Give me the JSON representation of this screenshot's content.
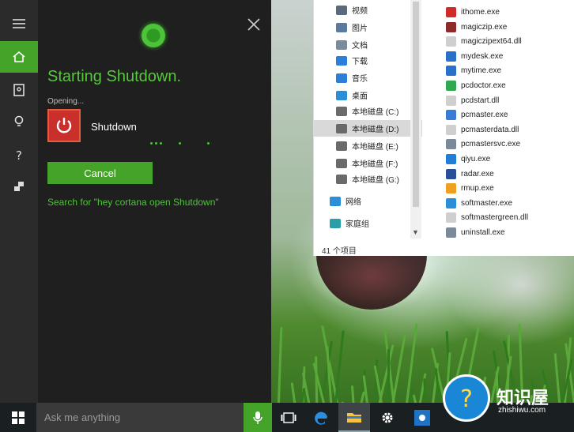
{
  "cortana": {
    "title": "Starting Shutdown.",
    "opening": "Opening...",
    "app_name": "Shutdown",
    "cancel_label": "Cancel",
    "search_link": "Search for \"hey cortana open Shutdown\"",
    "accent": "#45a32a"
  },
  "explorer": {
    "nav": [
      {
        "label": "视频",
        "icon": "video-icon"
      },
      {
        "label": "图片",
        "icon": "pictures-icon"
      },
      {
        "label": "文档",
        "icon": "documents-icon"
      },
      {
        "label": "下载",
        "icon": "downloads-icon"
      },
      {
        "label": "音乐",
        "icon": "music-icon"
      },
      {
        "label": "桌面",
        "icon": "desktop-icon"
      },
      {
        "label": "本地磁盘 (C:)",
        "icon": "drive-icon"
      },
      {
        "label": "本地磁盘 (D:)",
        "icon": "drive-icon",
        "selected": true
      },
      {
        "label": "本地磁盘 (E:)",
        "icon": "drive-icon"
      },
      {
        "label": "本地磁盘 (F:)",
        "icon": "drive-icon"
      },
      {
        "label": "本地磁盘 (G:)",
        "icon": "drive-icon"
      },
      {
        "label": "网络",
        "icon": "network-icon"
      },
      {
        "label": "家庭组",
        "icon": "homegroup-icon"
      }
    ],
    "files": [
      {
        "name": "ithome.exe",
        "color": "#d12a2a"
      },
      {
        "name": "magiczip.exe",
        "color": "#8b2b2b"
      },
      {
        "name": "magiczipext64.dll",
        "color": "#cfcfcf"
      },
      {
        "name": "mydesk.exe",
        "color": "#2a6fc9"
      },
      {
        "name": "mytime.exe",
        "color": "#2a6fc9"
      },
      {
        "name": "pcdoctor.exe",
        "color": "#2fa84f"
      },
      {
        "name": "pcdstart.dll",
        "color": "#cfcfcf"
      },
      {
        "name": "pcmaster.exe",
        "color": "#3a7bd5"
      },
      {
        "name": "pcmasterdata.dll",
        "color": "#cfcfcf"
      },
      {
        "name": "pcmastersvc.exe",
        "color": "#7a8a9a"
      },
      {
        "name": "qiyu.exe",
        "color": "#1f7fd8"
      },
      {
        "name": "radar.exe",
        "color": "#2a4f9a"
      },
      {
        "name": "rmup.exe",
        "color": "#f0a020"
      },
      {
        "name": "softmaster.exe",
        "color": "#2a8fd8"
      },
      {
        "name": "softmastergreen.dll",
        "color": "#cfcfcf"
      },
      {
        "name": "uninstall.exe",
        "color": "#7a8a9a"
      }
    ],
    "status": "41 个项目"
  },
  "taskbar": {
    "ask_placeholder": "Ask me anything"
  },
  "watermark": {
    "title": "知识屋",
    "site": "zhishiwu.com"
  }
}
